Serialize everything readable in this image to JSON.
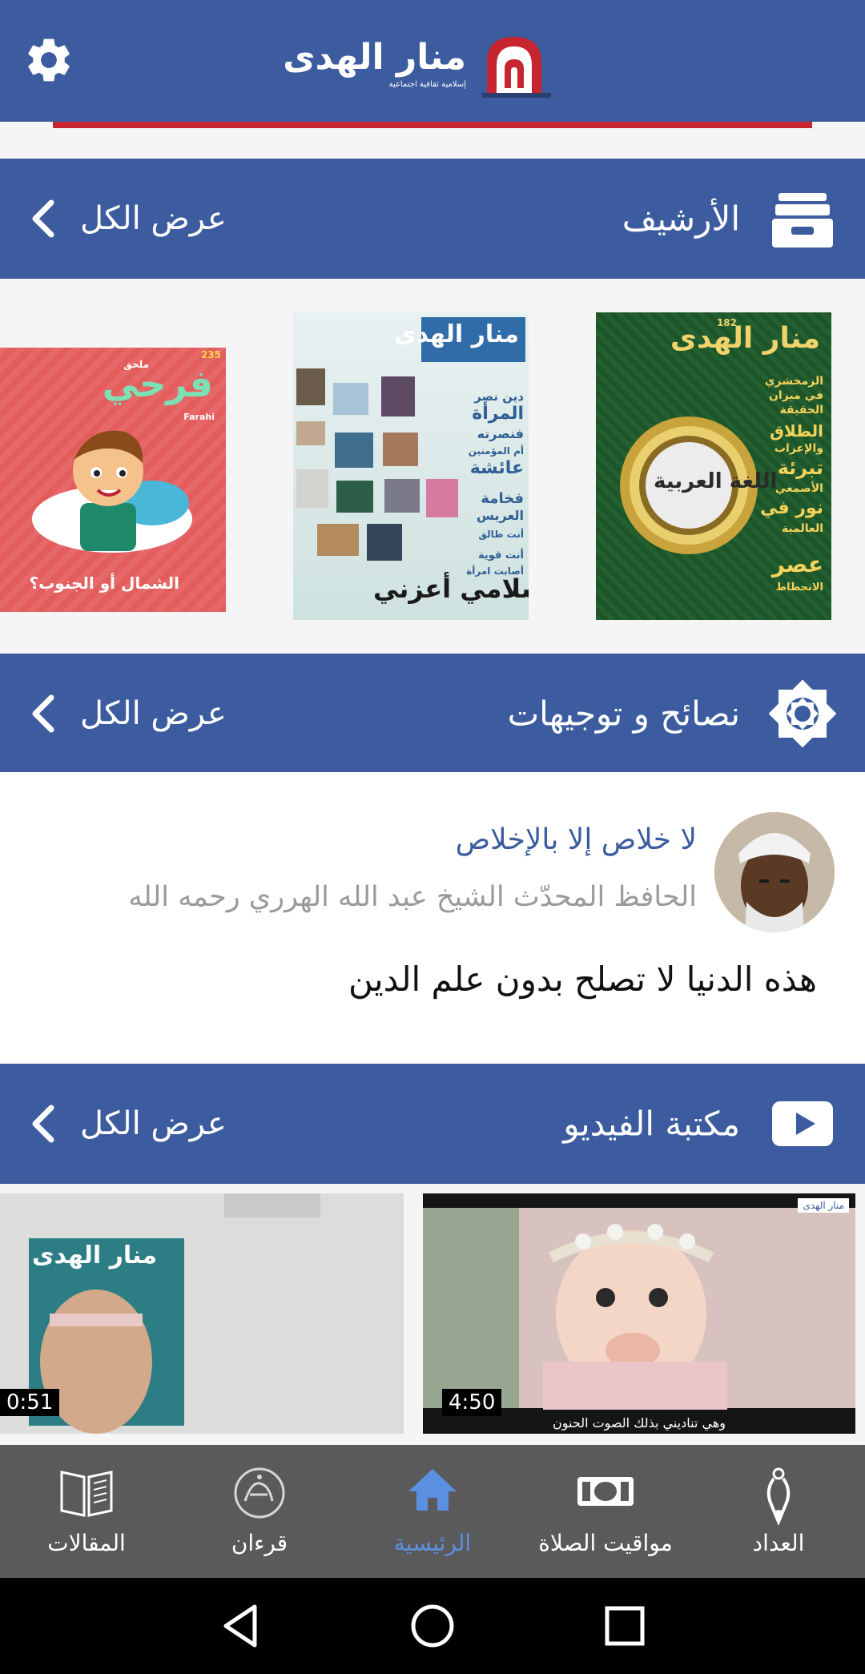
{
  "header": {
    "logo_name": "منار الهدى",
    "logo_sub": "إسلامية ثقافية اجتماعية"
  },
  "archive": {
    "title": "الأرشيف",
    "see_all": "عرض الكل",
    "covers": [
      {
        "masthead": "منار الهدى",
        "issue": "182",
        "headlines": [
          "الزمخشري",
          "في ميزان",
          "الحقيقة",
          "الطلاق",
          "والإعراب",
          "تبرئة",
          "الأصمعي",
          "نور في",
          "العالمية",
          "عصر",
          "الانحطاط"
        ],
        "seal": "اللغة العربية"
      },
      {
        "masthead": "منار الهدى",
        "headlines": [
          "دين نصر",
          "المرأة",
          "فنصرته",
          "أم المؤمنين",
          "عائشة",
          "فخامة",
          "العريس",
          "أنت طالق",
          "أنت قوية",
          "أصابت امرأة"
        ],
        "footer": "إسلامي أعزني"
      },
      {
        "masthead": "فرحي",
        "masthead_sub": "Farahi",
        "supplement": "ملحق",
        "issue": "235",
        "caption": "الشمال أو الجنوب؟"
      }
    ]
  },
  "advice": {
    "title": "نصائح و توجيهات",
    "see_all": "عرض الكل",
    "item_title": "لا خلاص إلا بالإخلاص",
    "item_author": "الحافظ المحدّث الشيخ عبد الله الهرري رحمه الله",
    "item_body": "هذه الدنيا لا تصلح بدون علم الدين"
  },
  "video": {
    "title": "مكتبة الفيديو",
    "see_all": "عرض الكل",
    "items": [
      {
        "duration": "4:50",
        "caption": "وهي تناديني بذلك الصوت الحنون",
        "badge": "منار الهدى"
      },
      {
        "duration": "0:51",
        "masthead": "منار الهدى"
      }
    ]
  },
  "nav": {
    "items": [
      {
        "label": "المقالات",
        "icon": "book-icon"
      },
      {
        "label": "قرءان",
        "icon": "quran-icon"
      },
      {
        "label": "الرئيسية",
        "icon": "home-icon",
        "active": true
      },
      {
        "label": "مواقيت الصلاة",
        "icon": "prayer-times-icon"
      },
      {
        "label": "العداد",
        "icon": "tasbih-icon"
      }
    ],
    "active_color": "#5b8fe0"
  },
  "colors": {
    "primary": "#3c5c9f",
    "accent": "#c6242f",
    "nav_bg": "#5a5a5a"
  }
}
